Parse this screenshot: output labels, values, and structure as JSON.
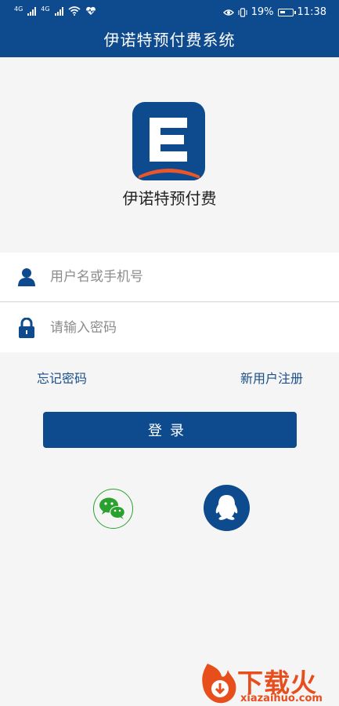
{
  "status_bar": {
    "sim1_label": "4G",
    "sim2_label": "4G",
    "battery_percent": "19%",
    "time": "11:38",
    "icons": [
      "signal-icon",
      "signal-icon",
      "wifi-icon",
      "heart-rate-icon",
      "eye-icon",
      "vibrate-icon",
      "battery-icon"
    ]
  },
  "header": {
    "title": "伊诺特预付费系统"
  },
  "brand": {
    "logo_letter": "E",
    "name": "伊诺特预付费"
  },
  "form": {
    "username_placeholder": "用户名或手机号",
    "password_placeholder": "请输入密码"
  },
  "links": {
    "forgot_password": "忘记密码",
    "register": "新用户注册"
  },
  "login_button": "登录",
  "third_party": [
    {
      "name": "wechat",
      "icon": "wechat-icon"
    },
    {
      "name": "qq",
      "icon": "qq-icon"
    }
  ],
  "watermark": {
    "text": "下载火",
    "url": "xiazaihuo.com"
  },
  "colors": {
    "primary": "#0d4a8e",
    "wechat_green": "#2aa12f",
    "accent_red": "#e84d1c",
    "logo_orange": "#e8562a"
  }
}
